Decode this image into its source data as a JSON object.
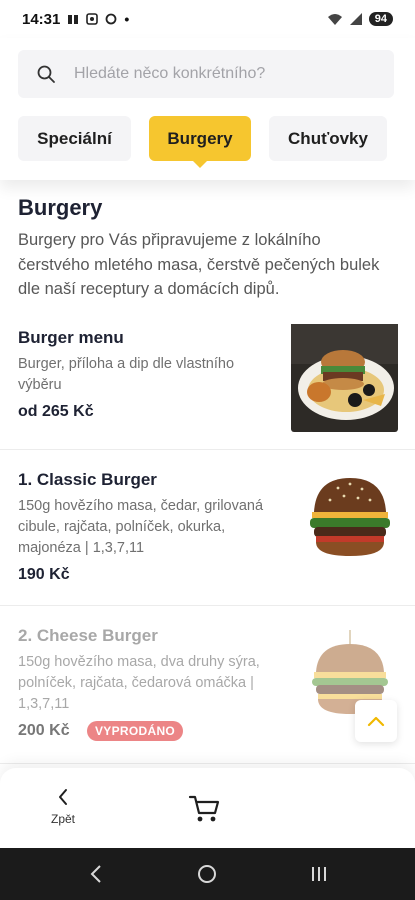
{
  "status_bar": {
    "time": "14:31",
    "battery": "94"
  },
  "search": {
    "placeholder": "Hledáte něco konkrétního?"
  },
  "tabs": [
    {
      "label": "Speciální",
      "active": false
    },
    {
      "label": "Burgery",
      "active": true
    },
    {
      "label": "Chuťovky",
      "active": false
    }
  ],
  "section": {
    "title": "Burgery",
    "description": "Burgery pro Vás připravujeme z lokálního čerstvého mletého masa, čerstvě pečených bulek dle naší receptury a domácích dipů."
  },
  "items": [
    {
      "name": "Burger menu",
      "description": "Burger, příloha a dip dle vlastního výběru",
      "price": "od 265 Kč",
      "sold_out": false
    },
    {
      "name": "1. Classic Burger",
      "description": "150g hovězího masa, čedar, grilovaná cibule, rajčata, polníček, okurka, majonéza | 1,3,7,11",
      "price": "190 Kč",
      "sold_out": false
    },
    {
      "name": "2. Cheese Burger",
      "description": "150g hovězího masa, dva druhy sýra, polníček, rajčata, čedarová omáčka | 1,3,7,11",
      "price": "200 Kč",
      "sold_out": true,
      "badge": "VYPRODÁNO"
    }
  ],
  "bottom_bar": {
    "back_label": "Zpět"
  },
  "colors": {
    "accent": "#f6c62f",
    "sold_out_badge": "#ec8586"
  },
  "icons": [
    "search-icon",
    "chevron-left-icon",
    "cart-icon",
    "chevron-up-icon",
    "nav-back-icon",
    "nav-home-icon",
    "nav-recents-icon"
  ]
}
